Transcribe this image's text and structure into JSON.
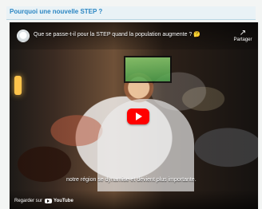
{
  "section": {
    "title": "Pourquoi une nouvelle STEP ?"
  },
  "video": {
    "title": "Que se passe-t-il pour la STEP quand la population augmente ? 🤔",
    "share_label": "Partager",
    "subtitle": "notre région se dynamise et devient plus importante.",
    "watch_on": "Regarder sur",
    "youtube_logo": "YouTube",
    "icons": {
      "share": "share-arrow-icon",
      "play": "youtube-play-icon",
      "avatar": "channel-avatar-icon"
    }
  },
  "colors": {
    "section_title": "#2b86c3",
    "section_bg": "#e9f2f6",
    "play_button": "#ff0000"
  }
}
